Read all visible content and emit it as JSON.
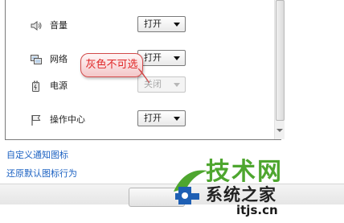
{
  "notification_rows": [
    {
      "icon": "volume-icon",
      "label": "音量",
      "value": "打开",
      "disabled": false
    },
    {
      "icon": "network-icon",
      "label": "网络",
      "value": "打开",
      "disabled": false
    },
    {
      "icon": "power-icon",
      "label": "电源",
      "value": "关闭",
      "disabled": true
    },
    {
      "icon": "action-center-flag-icon",
      "label": "操作中心",
      "value": "打开",
      "disabled": false
    }
  ],
  "callout": {
    "text": "灰色不可选",
    "color": "#e02525"
  },
  "links": {
    "customize": "自定义通知图标",
    "restore": "还原默认图标行为"
  },
  "watermark": {
    "brand_big": "技术网",
    "brand_mid": "系统之家",
    "url": "itjs.cn",
    "colors": {
      "green": "#4ea62f",
      "blue": "#1e5fb4"
    }
  },
  "colors": {
    "link": "#1b61c2",
    "panel_border": "#7b7b7b"
  }
}
